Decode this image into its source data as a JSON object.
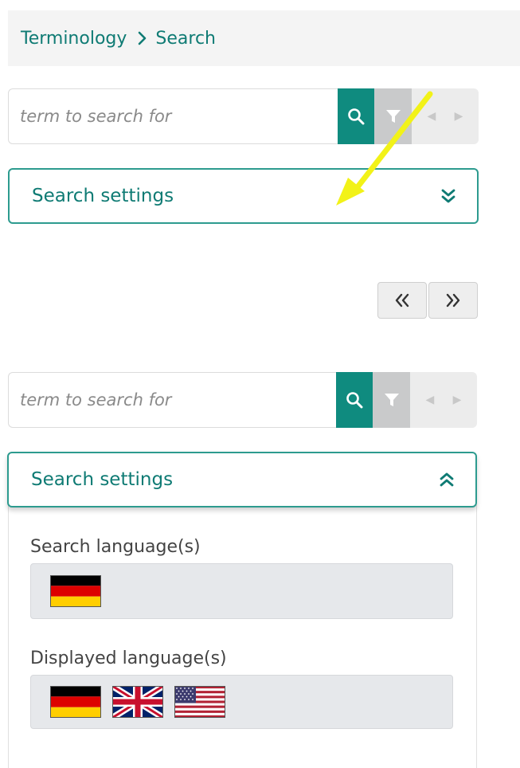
{
  "breadcrumb": {
    "items": [
      {
        "label": "Terminology"
      },
      {
        "label": "Search"
      }
    ]
  },
  "search_top": {
    "placeholder": "term to search for"
  },
  "settings_top": {
    "label": "Search settings",
    "state": "collapsed"
  },
  "search_bottom": {
    "placeholder": "term to search for"
  },
  "settings_bottom": {
    "label": "Search settings",
    "state": "expanded",
    "search_languages_label": "Search language(s)",
    "search_languages": [
      "de-flag-icon"
    ],
    "displayed_languages_label": "Displayed language(s)",
    "displayed_languages": [
      "de-flag-icon",
      "uk-flag-icon",
      "us-flag-icon"
    ]
  },
  "pager": {
    "prev_icon": "double-chevron-left-icon",
    "next_icon": "double-chevron-right-icon"
  },
  "colors": {
    "accent": "#0f8b7f",
    "breadcrumb_text": "#0f7b74",
    "annotation_arrow": "#f2f218"
  }
}
